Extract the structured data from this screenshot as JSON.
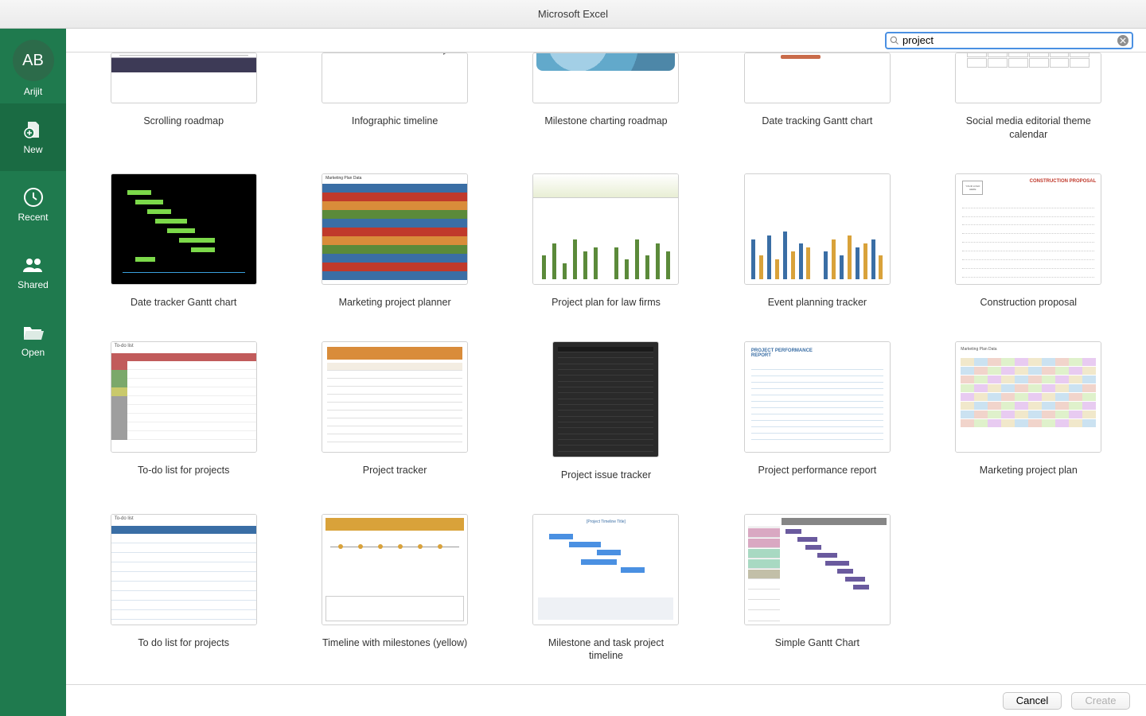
{
  "title": "Microsoft Excel",
  "user": {
    "initials": "AB",
    "name": "Arijit"
  },
  "sidebar": [
    {
      "label": "New",
      "icon": "document-plus-icon",
      "active": true
    },
    {
      "label": "Recent",
      "icon": "clock-icon"
    },
    {
      "label": "Shared",
      "icon": "people-icon"
    },
    {
      "label": "Open",
      "icon": "folder-open-icon"
    }
  ],
  "search": {
    "value": "project",
    "placeholder": "Search"
  },
  "templates": [
    {
      "label": "Scrolling roadmap",
      "thumb": "t1",
      "partial": true
    },
    {
      "label": "Infographic timeline",
      "thumb": "t2",
      "partial": true
    },
    {
      "label": "Milestone charting roadmap",
      "thumb": "t3",
      "partial": true
    },
    {
      "label": "Date tracking Gantt chart",
      "thumb": "t4",
      "partial": true
    },
    {
      "label": "Social media editorial theme calendar",
      "thumb": "t5",
      "partial": true
    },
    {
      "label": "Date tracker Gantt chart",
      "thumb": "t6"
    },
    {
      "label": "Marketing project planner",
      "thumb": "t7"
    },
    {
      "label": "Project plan for law firms",
      "thumb": "t8"
    },
    {
      "label": "Event planning tracker",
      "thumb": "t9"
    },
    {
      "label": "Construction proposal",
      "thumb": "t10"
    },
    {
      "label": "To-do list for projects",
      "thumb": "t11"
    },
    {
      "label": "Project tracker",
      "thumb": "t12"
    },
    {
      "label": "Project issue tracker",
      "thumb": "t13",
      "narrow": true
    },
    {
      "label": "Project performance report",
      "thumb": "t14"
    },
    {
      "label": "Marketing project plan",
      "thumb": "t15"
    },
    {
      "label": "To do list for projects",
      "thumb": "t16"
    },
    {
      "label": "Timeline with milestones (yellow)",
      "thumb": "t17"
    },
    {
      "label": "Milestone and task project timeline",
      "thumb": "t18"
    },
    {
      "label": "Simple Gantt Chart",
      "thumb": "t19"
    }
  ],
  "footer": {
    "cancel": "Cancel",
    "create": "Create"
  }
}
